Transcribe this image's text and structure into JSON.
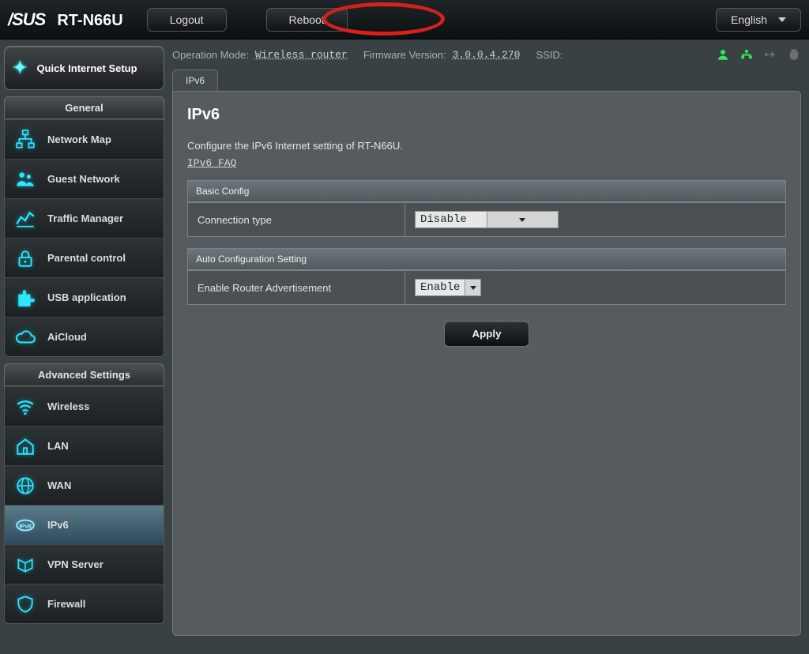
{
  "topbar": {
    "brand": "/SUS",
    "model": "RT-N66U",
    "logout": "Logout",
    "reboot": "Reboot",
    "language": "English"
  },
  "status": {
    "op_mode_label": "Operation Mode:",
    "op_mode_value": "Wireless router",
    "fw_label": "Firmware Version:",
    "fw_value": "3.0.0.4.270",
    "ssid_label": "SSID:"
  },
  "sidebar": {
    "qis": "Quick Internet Setup",
    "general_title": "General",
    "general_items": [
      "Network Map",
      "Guest Network",
      "Traffic Manager",
      "Parental control",
      "USB application",
      "AiCloud"
    ],
    "advanced_title": "Advanced Settings",
    "advanced_items": [
      "Wireless",
      "LAN",
      "WAN",
      "IPv6",
      "VPN Server",
      "Firewall"
    ]
  },
  "tab": "IPv6",
  "page": {
    "title": "IPv6",
    "desc": "Configure the IPv6 Internet setting of RT-N66U.",
    "faq": "IPv6 FAQ",
    "basic_head": "Basic Config",
    "conn_type_label": "Connection type",
    "conn_type_value": "Disable",
    "auto_head": "Auto Configuration Setting",
    "era_label": "Enable Router Advertisement",
    "era_value": "Enable",
    "apply": "Apply"
  }
}
